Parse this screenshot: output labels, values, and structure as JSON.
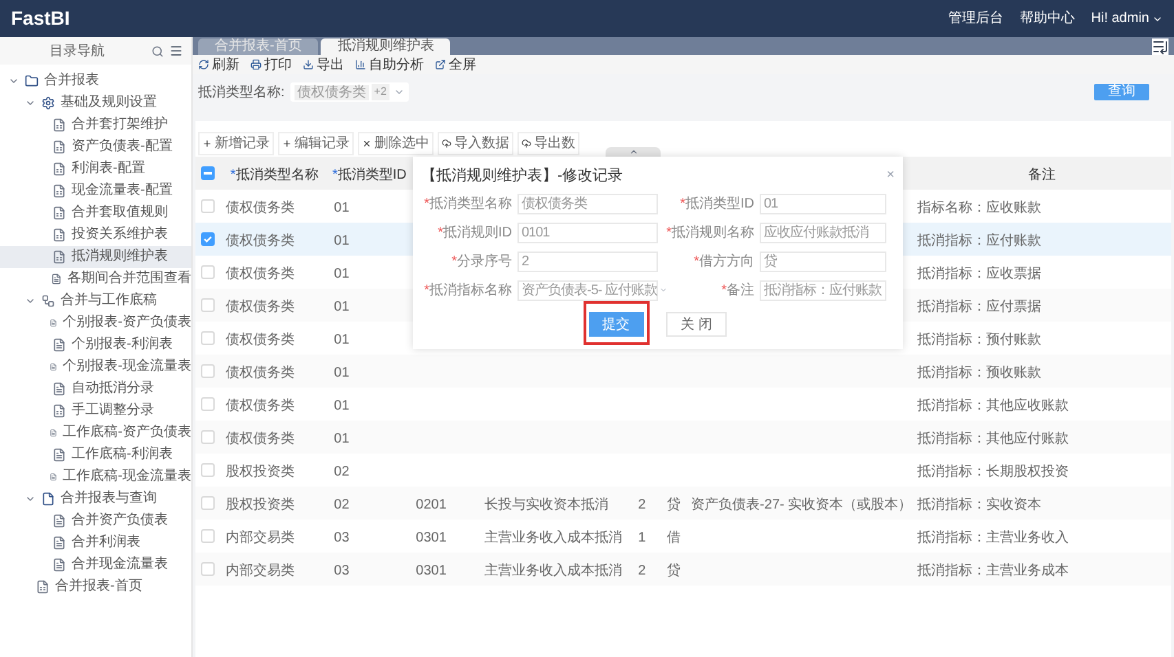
{
  "header": {
    "logo": "FastBI",
    "links": [
      "管理后台",
      "帮助中心"
    ],
    "user": "Hi! admin"
  },
  "sidebar": {
    "title": "目录导航",
    "tree": [
      {
        "label": "合并报表",
        "kind": "folder",
        "expanded": true,
        "selected": false,
        "children": [
          {
            "label": "基础及规则设置",
            "kind": "gear",
            "expanded": true,
            "selected": false,
            "children": [
              {
                "label": "合并套打架维护",
                "kind": "form",
                "selected": false
              },
              {
                "label": "资产负债表-配置",
                "kind": "form",
                "selected": false
              },
              {
                "label": "利润表-配置",
                "kind": "form",
                "selected": false
              },
              {
                "label": "现金流量表-配置",
                "kind": "form",
                "selected": false
              },
              {
                "label": "合并套取值规则",
                "kind": "form",
                "selected": false
              },
              {
                "label": "投资关系维护表",
                "kind": "form",
                "selected": false
              },
              {
                "label": "抵消规则维护表",
                "kind": "form",
                "selected": true
              },
              {
                "label": "各期间合并范围查看",
                "kind": "report",
                "selected": false
              }
            ]
          },
          {
            "label": "合并与工作底稿",
            "kind": "flow",
            "expanded": true,
            "selected": false,
            "children": [
              {
                "label": "个别报表-资产负债表",
                "kind": "report",
                "selected": false
              },
              {
                "label": "个别报表-利润表",
                "kind": "report",
                "selected": false
              },
              {
                "label": "个别报表-现金流量表",
                "kind": "report",
                "selected": false
              },
              {
                "label": "自动抵消分录",
                "kind": "report",
                "selected": false
              },
              {
                "label": "手工调整分录",
                "kind": "form",
                "selected": false
              },
              {
                "label": "工作底稿-资产负债表",
                "kind": "report",
                "selected": false
              },
              {
                "label": "工作底稿-利润表",
                "kind": "report",
                "selected": false
              },
              {
                "label": "工作底稿-现金流量表",
                "kind": "report",
                "selected": false
              }
            ]
          },
          {
            "label": "合并报表与查询",
            "kind": "file",
            "expanded": true,
            "selected": false,
            "children": [
              {
                "label": "合并资产负债表",
                "kind": "report",
                "selected": false
              },
              {
                "label": "合并利润表",
                "kind": "report",
                "selected": false
              },
              {
                "label": "合并现金流量表",
                "kind": "report",
                "selected": false
              }
            ]
          },
          {
            "label": "合并报表-首页",
            "kind": "form",
            "selected": false
          }
        ]
      }
    ]
  },
  "tabs": [
    {
      "label": "合并报表-首页",
      "selected": false
    },
    {
      "label": "抵消规则维护表",
      "selected": true
    }
  ],
  "toolbar": [
    {
      "label": "刷新",
      "kind": "refresh"
    },
    {
      "label": "打印",
      "kind": "print"
    },
    {
      "label": "导出",
      "kind": "export"
    },
    {
      "label": "自助分析",
      "kind": "chart"
    },
    {
      "label": "全屏",
      "kind": "fullscreen"
    }
  ],
  "filter": {
    "label": "抵消类型名称:",
    "tags": [
      "债权债务类"
    ],
    "more": "+2",
    "button": "查询"
  },
  "table_toolbar": [
    {
      "label": "新增记录",
      "kind": "plus"
    },
    {
      "label": "编辑记录",
      "kind": "plus"
    },
    {
      "label": "删除选中",
      "kind": "delete"
    },
    {
      "label": "导入数据",
      "kind": "cloud"
    },
    {
      "label": "导出数",
      "kind": "cloud"
    }
  ],
  "table": {
    "header_checkbox": {
      "indeterminate": true
    },
    "columns": [
      {
        "mark": "*",
        "label": "抵消类型名称"
      },
      {
        "mark": "*",
        "label": "抵消类型ID"
      },
      {},
      {},
      {},
      {},
      {},
      {
        "label": "备注"
      }
    ],
    "rows": [
      {
        "checked": false,
        "cells": [
          "债权债务类",
          "01",
          null,
          null,
          null,
          null,
          null,
          "指标名称：应收账款"
        ]
      },
      {
        "checked": true,
        "cells": [
          "债权债务类",
          "01",
          null,
          null,
          null,
          null,
          null,
          "抵消指标：应付账款"
        ]
      },
      {
        "checked": false,
        "cells": [
          "债权债务类",
          "01",
          null,
          null,
          null,
          null,
          null,
          "抵消指标：应收票据"
        ]
      },
      {
        "checked": false,
        "cells": [
          "债权债务类",
          "01",
          null,
          null,
          null,
          null,
          null,
          "抵消指标：应付票据"
        ]
      },
      {
        "checked": false,
        "cells": [
          "债权债务类",
          "01",
          null,
          null,
          null,
          null,
          null,
          "抵消指标：预付账款"
        ]
      },
      {
        "checked": false,
        "cells": [
          "债权债务类",
          "01",
          null,
          null,
          null,
          null,
          null,
          "抵消指标：预收账款"
        ]
      },
      {
        "checked": false,
        "cells": [
          "债权债务类",
          "01",
          null,
          null,
          null,
          null,
          null,
          "抵消指标：其他应收账款"
        ]
      },
      {
        "checked": false,
        "cells": [
          "债权债务类",
          "01",
          null,
          null,
          null,
          null,
          null,
          "抵消指标：其他应付账款"
        ]
      },
      {
        "checked": false,
        "cells": [
          "股权投资类",
          "02",
          null,
          null,
          null,
          null,
          null,
          "抵消指标：长期股权投资"
        ]
      },
      {
        "checked": false,
        "cells": [
          "股权投资类",
          "02",
          "0201",
          "长投与实收资本抵消",
          "2",
          "贷",
          "资产负债表-27- 实收资本（或股本）",
          "抵消指标：实收资本"
        ]
      },
      {
        "checked": false,
        "cells": [
          "内部交易类",
          "03",
          "0301",
          "主营业务收入成本抵消",
          "1",
          "借",
          null,
          "抵消指标：主营业务收入"
        ]
      },
      {
        "checked": false,
        "cells": [
          "内部交易类",
          "03",
          "0301",
          "主营业务收入成本抵消",
          "2",
          "贷",
          null,
          "抵消指标：主营业务成本"
        ]
      }
    ]
  },
  "dialog": {
    "title": "【抵消规则维护表】-修改记录",
    "close": "×",
    "fields": [
      {
        "mark": "*",
        "label": "抵消类型名称",
        "value": "债权债务类",
        "kind": "text"
      },
      {
        "mark": "*",
        "label": "抵消类型ID",
        "value": "01",
        "kind": "text"
      },
      {
        "mark": "*",
        "label": "抵消规则ID",
        "value": "0101",
        "kind": "text"
      },
      {
        "mark": "*",
        "label": "抵消规则名称",
        "value": "应收应付账款抵消",
        "kind": "text"
      },
      {
        "mark": "*",
        "label": "分录序号",
        "value": "2",
        "kind": "text"
      },
      {
        "mark": "*",
        "label": "借方方向",
        "value": "贷",
        "kind": "text"
      },
      {
        "mark": "*",
        "label": "抵消指标名称",
        "value": "资产负债表-5- 应付账款",
        "kind": "select"
      },
      {
        "mark": "*",
        "label": "备注",
        "value": "抵消指标：应付账款",
        "kind": "text"
      }
    ],
    "buttons": [
      {
        "label": "提交",
        "kind": "primary",
        "highlighted": true
      },
      {
        "label": "关 闭",
        "kind": "default",
        "highlighted": false
      }
    ]
  }
}
